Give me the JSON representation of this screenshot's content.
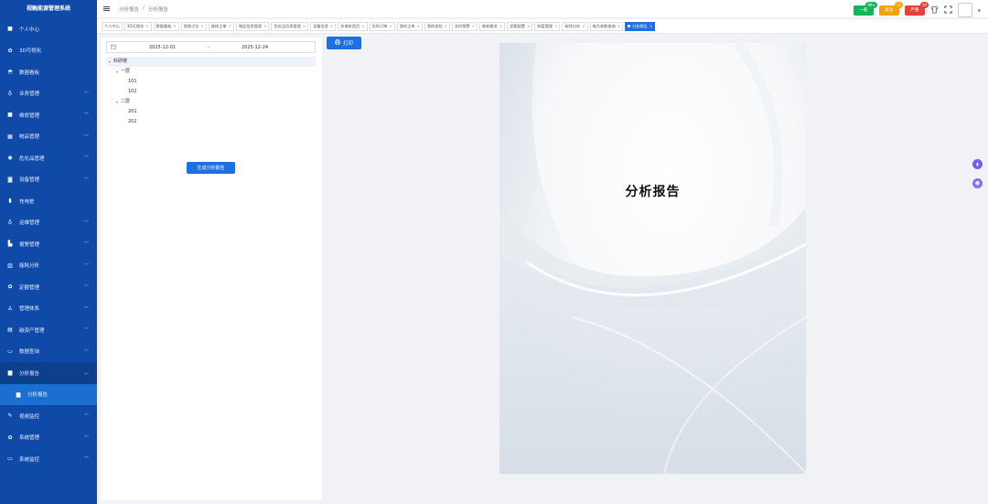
{
  "app": {
    "title": "视融能源管理系统"
  },
  "sidebar": {
    "items": [
      {
        "label": "个人中心",
        "icon": "user-icon",
        "glyph": "■",
        "chevron": false
      },
      {
        "label": "3D可视化",
        "icon": "gear-icon",
        "glyph": "✿",
        "chevron": false
      },
      {
        "label": "数据看板",
        "icon": "dashboard-icon",
        "glyph": "◓",
        "chevron": false
      },
      {
        "label": "业务管理",
        "icon": "business-icon",
        "glyph": "♁",
        "chevron": true
      },
      {
        "label": "维修管理",
        "icon": "repair-icon",
        "glyph": "■",
        "chevron": true
      },
      {
        "label": "物品管理",
        "icon": "goods-icon",
        "glyph": "▦",
        "chevron": true
      },
      {
        "label": "危化品管理",
        "icon": "chemical-icon",
        "glyph": "◉",
        "chevron": true
      },
      {
        "label": "设备管理",
        "icon": "device-icon",
        "glyph": "◙",
        "chevron": true
      },
      {
        "label": "充电桩",
        "icon": "charging-icon",
        "glyph": "▮",
        "chevron": false
      },
      {
        "label": "运维管理",
        "icon": "ops-icon",
        "glyph": "♁",
        "chevron": true
      },
      {
        "label": "报警管理",
        "icon": "alarm-icon",
        "glyph": "▙",
        "chevron": true
      },
      {
        "label": "能耗分析",
        "icon": "energy-icon",
        "glyph": "▥",
        "chevron": true
      },
      {
        "label": "定额管理",
        "icon": "quota-icon",
        "glyph": "✿",
        "chevron": true
      },
      {
        "label": "管理体系",
        "icon": "system-icon",
        "glyph": "♙",
        "chevron": true
      },
      {
        "label": "碳资产管理",
        "icon": "carbon-icon",
        "glyph": "▤",
        "chevron": true
      },
      {
        "label": "数据查询",
        "icon": "query-icon",
        "glyph": "▭",
        "chevron": true
      },
      {
        "label": "分析报告",
        "icon": "report-icon",
        "glyph": "▆",
        "chevron": true,
        "open": true
      },
      {
        "label": "分析报告",
        "icon": "report-doc-icon",
        "glyph": "▆",
        "chevron": false,
        "sub": true
      },
      {
        "label": "视频监控",
        "icon": "video-icon",
        "glyph": "✎",
        "chevron": true
      },
      {
        "label": "系统管理",
        "icon": "settings-icon",
        "glyph": "✿",
        "chevron": true
      },
      {
        "label": "系统监控",
        "icon": "monitor-icon",
        "glyph": "▭",
        "chevron": true
      }
    ]
  },
  "header": {
    "breadcrumb": [
      "分析报告",
      "/",
      "分析报告"
    ],
    "alarms": [
      {
        "label": "一般",
        "badge": "99+",
        "color": "#17b35a",
        "badge_color": "#17b35a"
      },
      {
        "label": "紧急",
        "badge": "10",
        "color": "#f2a20b",
        "badge_color": "#f2a20b"
      },
      {
        "label": "严重",
        "badge": "10",
        "color": "#e5413a",
        "badge_color": "#e5413a"
      }
    ]
  },
  "tags": [
    {
      "label": "个人中心",
      "closable": false
    },
    {
      "label": "3D可视化",
      "closable": true
    },
    {
      "label": "数据看板",
      "closable": true
    },
    {
      "label": "视频点位",
      "closable": true
    },
    {
      "label": "维修工单",
      "closable": true
    },
    {
      "label": "物品信息管理",
      "closable": true
    },
    {
      "label": "危化品信息管理",
      "closable": true
    },
    {
      "label": "设备信息",
      "closable": true
    },
    {
      "label": "充电桩首页",
      "closable": true
    },
    {
      "label": "实时订单",
      "closable": true
    },
    {
      "label": "我的工单",
      "closable": true
    },
    {
      "label": "我的巡检",
      "closable": true
    },
    {
      "label": "实时报警",
      "closable": true
    },
    {
      "label": "能耗概览",
      "closable": true
    },
    {
      "label": "定额配置",
      "closable": true
    },
    {
      "label": "制度管理",
      "closable": true
    },
    {
      "label": "碳排分析",
      "closable": true
    },
    {
      "label": "电力参数查询",
      "closable": true
    },
    {
      "label": "分析报告",
      "closable": true,
      "active": true
    }
  ],
  "filter": {
    "start_date": "2025-12-01",
    "separator": "-",
    "end_date": "2025-12-24"
  },
  "tree": [
    {
      "label": "科研楼",
      "level": 0,
      "expanded": true
    },
    {
      "label": "一层",
      "level": 1,
      "expanded": true
    },
    {
      "label": "101",
      "level": 2
    },
    {
      "label": "102",
      "level": 2
    },
    {
      "label": "二层",
      "level": 1,
      "expanded": true
    },
    {
      "label": "201",
      "level": 2
    },
    {
      "label": "202",
      "level": 2
    }
  ],
  "actions": {
    "generate_label": "生成分析报告",
    "print_label": "打印"
  },
  "report": {
    "title": "分析报告"
  },
  "colors": {
    "sidebar": "#0f4aa8",
    "accent": "#1e6fe0"
  }
}
